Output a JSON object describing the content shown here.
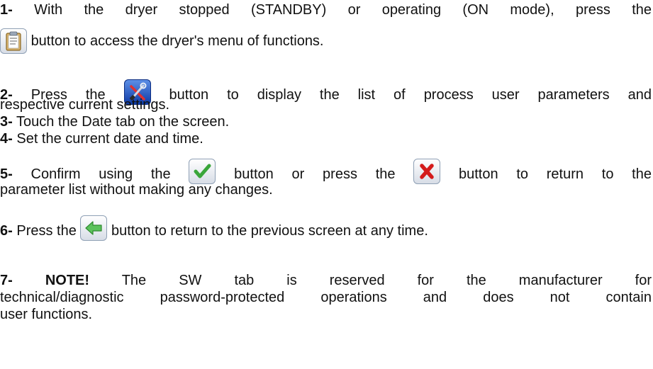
{
  "steps": [
    {
      "num": "1-",
      "l1": "With the dryer stopped (STANDBY) or operating (ON mode), press the",
      "l2": "button to access the dryer's menu of functions.",
      "icon": "clipboard-menu-icon"
    },
    {
      "num": "2-",
      "l1a": "Press the",
      "l1b": "button to display the list of process user parameters and",
      "l2": "respective current settings.",
      "icon": "tools-parameters-icon"
    },
    {
      "num": "3-",
      "text": "Touch the Date tab on the screen."
    },
    {
      "num": "4-",
      "text": "Set the current date and time."
    },
    {
      "num": "5-",
      "a": "Confirm using the",
      "b": "button or press the",
      "c": "button to return to the",
      "l2": "parameter list without making any changes.",
      "icon_confirm": "check-confirm-icon",
      "icon_cancel": "x-cancel-icon"
    },
    {
      "num": "6-",
      "a": "Press the",
      "b": "button to return to the previous screen at any time.",
      "icon": "back-arrow-icon"
    },
    {
      "num": "7-",
      "note": "NOTE!",
      "l1": "The SW tab is reserved for the manufacturer for",
      "l2": "technical/diagnostic password-protected operations and does not contain",
      "l3": "user functions."
    }
  ]
}
